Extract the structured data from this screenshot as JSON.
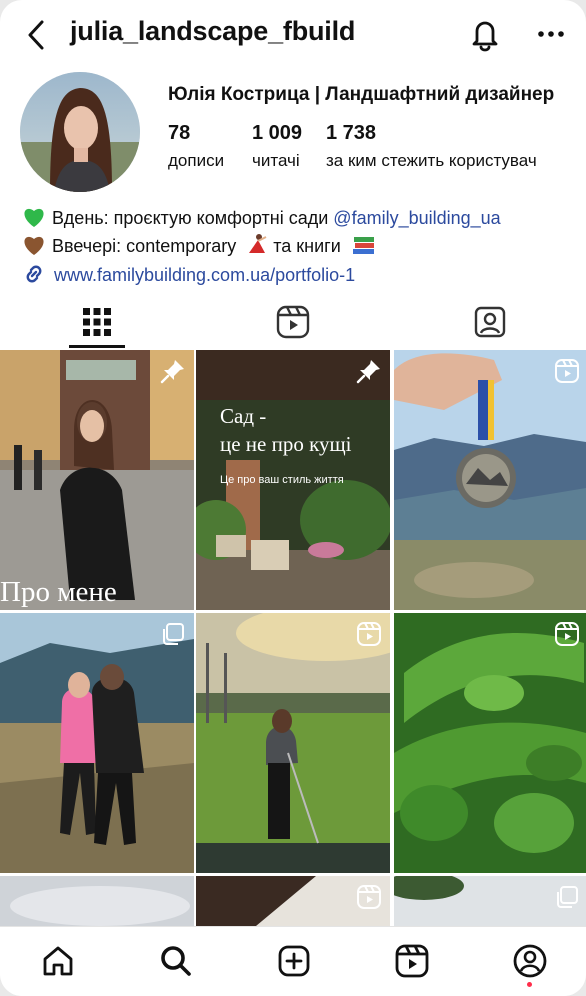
{
  "header": {
    "username": "julia_landscape_fbuild",
    "back_icon": "chevron-left-icon",
    "notify_icon": "bell-icon",
    "more_icon": "more-horizontal-icon"
  },
  "profile": {
    "full_name": "Юлія Кострица | Ландшафтний дизайнер",
    "stats": [
      {
        "value": "78",
        "label": "дописи"
      },
      {
        "value": "1 009",
        "label": "читачі"
      },
      {
        "value": "1 738",
        "label": "за ким стежить користувач"
      }
    ],
    "bio": {
      "line1_emoji": "green-heart-icon",
      "line1_text": "Вдень: проєктую комфортні сади",
      "line1_mention": "@family_building_ua",
      "line2_emoji": "brown-heart-icon",
      "line2_text": "Ввечері: contemporary",
      "line2_dancer": "dancer-icon",
      "line2_after": "та книги",
      "line2_books": "books-icon"
    },
    "link": "www.familybuilding.com.ua/portfolio-1"
  },
  "tabs": [
    {
      "name": "grid",
      "icon": "grid-icon",
      "active": true
    },
    {
      "name": "reels",
      "icon": "reels-icon",
      "active": false
    },
    {
      "name": "tagged",
      "icon": "tagged-user-icon",
      "active": false
    }
  ],
  "posts": [
    {
      "badge": "pin-icon",
      "caption": "Про мене"
    },
    {
      "badge": "pin-icon",
      "title_line1": "Сад -",
      "title_line2": "це не про кущі",
      "subtitle": "Це про ваш стиль життя"
    },
    {
      "badge": "reels-icon"
    },
    {
      "badge": "carousel-icon"
    },
    {
      "badge": "reels-icon"
    },
    {
      "badge": "reels-icon"
    },
    {
      "badge": ""
    },
    {
      "badge": "reels-icon"
    },
    {
      "badge": "carousel-icon"
    }
  ],
  "bottom_nav": [
    {
      "icon": "home-icon"
    },
    {
      "icon": "search-icon"
    },
    {
      "icon": "create-post-icon"
    },
    {
      "icon": "reels-icon"
    },
    {
      "icon": "profile-icon"
    }
  ],
  "colors": {
    "link": "#2c4a9e",
    "notification_dot": "#ff2d4a"
  }
}
